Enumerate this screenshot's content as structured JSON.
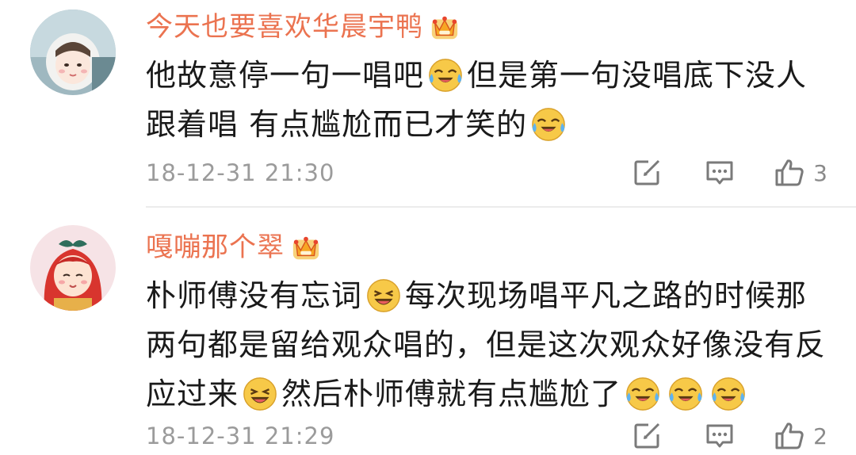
{
  "comments": [
    {
      "username": "今天也要喜欢华晨宇鸭",
      "lines": [
        [
          "他故意停一句一唱吧",
          ":laugh-cry:",
          "但是第一句没唱底下没人"
        ],
        [
          "跟着唱 有点尴尬而已才笑的",
          ":laugh-cry:"
        ]
      ],
      "line1_a": "他故意停一句一唱吧",
      "line1_b": "但是第一句没唱底下没人",
      "line2_a": "跟着唱 有点尴尬而已才笑的",
      "timestamp": "18-12-31 21:30",
      "likes": "3"
    },
    {
      "username": "嘎嘣那个翠",
      "line1_a": "朴师傅没有忘词",
      "line1_b": "每次现场唱平凡之路的时候那",
      "line2_a": "两句都是留给观众唱的，但是这次观众好像没有反",
      "line3_a": "应过来",
      "line3_b": "然后朴师傅就有点尴尬了",
      "timestamp": "18-12-31 21:29",
      "likes": "2"
    }
  ],
  "icons": {
    "vip": "crown-badge-icon",
    "emoji_laugh_cry": "laugh-cry-emoji-icon",
    "emoji_laugh": "laughing-emoji-icon",
    "repost": "repost-icon",
    "reply": "comment-icon",
    "like": "thumbs-up-icon"
  },
  "colors": {
    "username": "#eb7350",
    "text": "#1a1a1a",
    "meta": "#9b9b9b",
    "emoji_face": "#f7c948"
  }
}
